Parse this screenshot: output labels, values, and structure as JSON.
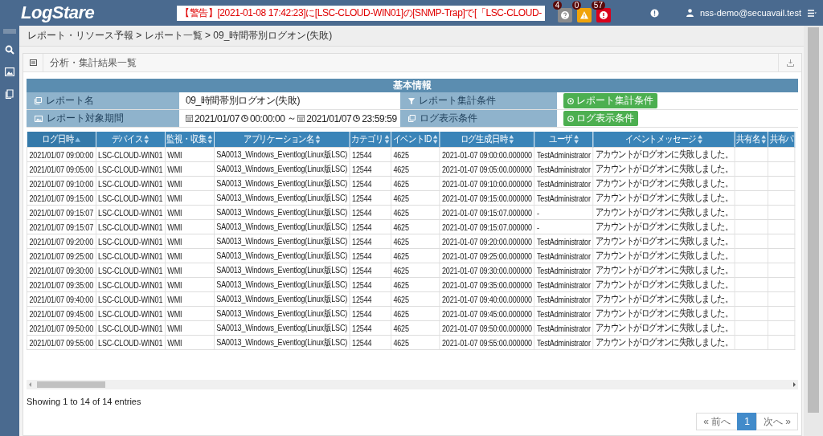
{
  "header": {
    "logo": "LogStare",
    "alert": "【警告】[2021-01-08 17:42:23]に[LSC-CLOUD-WIN01]の[SNMP-Trap]で[「LSC-CLOUD-",
    "badges": [
      {
        "count": "4",
        "kind": "question",
        "color": "#8c8c8c"
      },
      {
        "count": "0",
        "kind": "warning",
        "color": "#f0a30a"
      },
      {
        "count": "57",
        "kind": "error",
        "color": "#d9001b"
      }
    ],
    "user": "nss-demo@secuavail.test"
  },
  "sidebar": {
    "items": [
      {
        "kind": "search"
      },
      {
        "kind": "image"
      },
      {
        "kind": "book"
      }
    ]
  },
  "breadcrumb": "レポート・リソース予報 > レポート一覧 > 09_時間帯別ログオン(失敗)",
  "panel": {
    "title": "分析・集計結果一覧",
    "info": {
      "title": "基本情報",
      "report_name_label": "レポート名",
      "report_name": "09_時間帯別ログオン(失敗)",
      "period_label": "レポート対象期間",
      "period": {
        "start_date": "2021/01/07",
        "start_time": "00:00:00",
        "separator": "～",
        "end_date": "2021/01/07",
        "end_time": "23:59:59"
      },
      "aggregate_label": "レポート集計条件",
      "aggregate_button": "レポート集計条件",
      "display_label": "ログ表示条件",
      "display_button": "ログ表示条件"
    },
    "table": {
      "columns": [
        {
          "label": "ログ日時",
          "sortable": true,
          "sorted": true
        },
        {
          "label": "デバイス",
          "sortable": true,
          "sorted": false
        },
        {
          "label": "監視・収集",
          "sortable": true,
          "sorted": false
        },
        {
          "label": "アプリケーション名",
          "sortable": true,
          "sorted": false
        },
        {
          "label": "カテゴリ",
          "sortable": true,
          "sorted": false
        },
        {
          "label": "イベントID",
          "sortable": true,
          "sorted": false
        },
        {
          "label": "ログ生成日時",
          "sortable": true,
          "sorted": false
        },
        {
          "label": "ユーザ",
          "sortable": true,
          "sorted": false
        },
        {
          "label": "イベントメッセージ",
          "sortable": true,
          "sorted": false
        },
        {
          "label": "共有名",
          "sortable": true,
          "sorted": false
        },
        {
          "label": "共有パ",
          "sortable": false,
          "sorted": false
        }
      ],
      "rows": [
        [
          "2021/01/07 09:00:00",
          "LSC-CLOUD-WIN01",
          "WMI",
          "SA0013_Windows_Eventlog(Linux版LSC)",
          "12544",
          "4625",
          "2021-01-07 09:00:00.000000",
          "TestAdministrator",
          "アカウントがログオンに失敗しました。"
        ],
        [
          "2021/01/07 09:05:00",
          "LSC-CLOUD-WIN01",
          "WMI",
          "SA0013_Windows_Eventlog(Linux版LSC)",
          "12544",
          "4625",
          "2021-01-07 09:05:00.000000",
          "TestAdministrator",
          "アカウントがログオンに失敗しました。"
        ],
        [
          "2021/01/07 09:10:00",
          "LSC-CLOUD-WIN01",
          "WMI",
          "SA0013_Windows_Eventlog(Linux版LSC)",
          "12544",
          "4625",
          "2021-01-07 09:10:00.000000",
          "TestAdministrator",
          "アカウントがログオンに失敗しました。"
        ],
        [
          "2021/01/07 09:15:00",
          "LSC-CLOUD-WIN01",
          "WMI",
          "SA0013_Windows_Eventlog(Linux版LSC)",
          "12544",
          "4625",
          "2021-01-07 09:15:00.000000",
          "TestAdministrator",
          "アカウントがログオンに失敗しました。"
        ],
        [
          "2021/01/07 09:15:07",
          "LSC-CLOUD-WIN01",
          "WMI",
          "SA0013_Windows_Eventlog(Linux版LSC)",
          "12544",
          "4625",
          "2021-01-07 09:15:07.000000",
          "-",
          "アカウントがログオンに失敗しました。"
        ],
        [
          "2021/01/07 09:15:07",
          "LSC-CLOUD-WIN01",
          "WMI",
          "SA0013_Windows_Eventlog(Linux版LSC)",
          "12544",
          "4625",
          "2021-01-07 09:15:07.000000",
          "-",
          "アカウントがログオンに失敗しました。"
        ],
        [
          "2021/01/07 09:20:00",
          "LSC-CLOUD-WIN01",
          "WMI",
          "SA0013_Windows_Eventlog(Linux版LSC)",
          "12544",
          "4625",
          "2021-01-07 09:20:00.000000",
          "TestAdministrator",
          "アカウントがログオンに失敗しました。"
        ],
        [
          "2021/01/07 09:25:00",
          "LSC-CLOUD-WIN01",
          "WMI",
          "SA0013_Windows_Eventlog(Linux版LSC)",
          "12544",
          "4625",
          "2021-01-07 09:25:00.000000",
          "TestAdministrator",
          "アカウントがログオンに失敗しました。"
        ],
        [
          "2021/01/07 09:30:00",
          "LSC-CLOUD-WIN01",
          "WMI",
          "SA0013_Windows_Eventlog(Linux版LSC)",
          "12544",
          "4625",
          "2021-01-07 09:30:00.000000",
          "TestAdministrator",
          "アカウントがログオンに失敗しました。"
        ],
        [
          "2021/01/07 09:35:00",
          "LSC-CLOUD-WIN01",
          "WMI",
          "SA0013_Windows_Eventlog(Linux版LSC)",
          "12544",
          "4625",
          "2021-01-07 09:35:00.000000",
          "TestAdministrator",
          "アカウントがログオンに失敗しました。"
        ],
        [
          "2021/01/07 09:40:00",
          "LSC-CLOUD-WIN01",
          "WMI",
          "SA0013_Windows_Eventlog(Linux版LSC)",
          "12544",
          "4625",
          "2021-01-07 09:40:00.000000",
          "TestAdministrator",
          "アカウントがログオンに失敗しました。"
        ],
        [
          "2021/01/07 09:45:00",
          "LSC-CLOUD-WIN01",
          "WMI",
          "SA0013_Windows_Eventlog(Linux版LSC)",
          "12544",
          "4625",
          "2021-01-07 09:45:00.000000",
          "TestAdministrator",
          "アカウントがログオンに失敗しました。"
        ],
        [
          "2021/01/07 09:50:00",
          "LSC-CLOUD-WIN01",
          "WMI",
          "SA0013_Windows_Eventlog(Linux版LSC)",
          "12544",
          "4625",
          "2021-01-07 09:50:00.000000",
          "TestAdministrator",
          "アカウントがログオンに失敗しました。"
        ],
        [
          "2021/01/07 09:55:00",
          "LSC-CLOUD-WIN01",
          "WMI",
          "SA0013_Windows_Eventlog(Linux版LSC)",
          "12544",
          "4625",
          "2021-01-07 09:55:00.000000",
          "TestAdministrator",
          "アカウントがログオンに失敗しました。"
        ]
      ]
    },
    "summary": "Showing 1 to 14 of 14 entries",
    "pagination": [
      {
        "label": "« 前へ",
        "selected": false,
        "disabled": true
      },
      {
        "label": "1",
        "selected": true,
        "disabled": false
      },
      {
        "label": "次へ »",
        "selected": false,
        "disabled": true
      }
    ]
  }
}
